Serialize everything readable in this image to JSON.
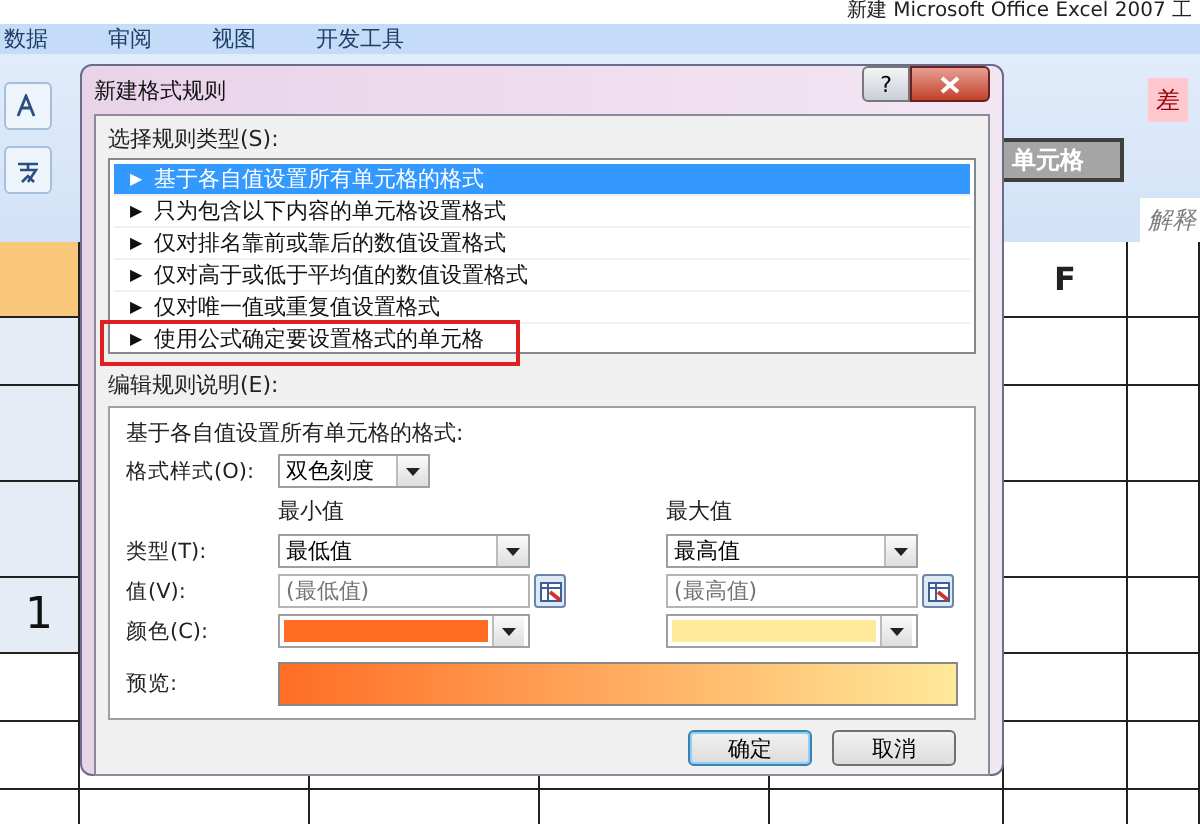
{
  "app_title": "新建 Microsoft Office Excel 2007 工",
  "ribbon_tabs": [
    {
      "label": "数据"
    },
    {
      "label": "审阅"
    },
    {
      "label": "视图"
    },
    {
      "label": "开发工具"
    }
  ],
  "cell_styles": [
    {
      "label": "差",
      "kind": "bad"
    },
    {
      "label": "单元格",
      "kind": "check"
    },
    {
      "label": "解释",
      "kind": "note"
    }
  ],
  "sheet": {
    "column_header": "F",
    "cell_text": "1"
  },
  "dialog": {
    "title": "新建格式规则",
    "help": "?",
    "rule_type_label": "选择规则类型(S):",
    "rule_types": [
      {
        "arrow": "▶",
        "label": "基于各自值设置所有单元格的格式",
        "selected": true,
        "highlighted": false
      },
      {
        "arrow": "▶",
        "label": "只为包含以下内容的单元格设置格式",
        "selected": false,
        "highlighted": false
      },
      {
        "arrow": "▶",
        "label": "仅对排名靠前或靠后的数值设置格式",
        "selected": false,
        "highlighted": false
      },
      {
        "arrow": "▶",
        "label": "仅对高于或低于平均值的数值设置格式",
        "selected": false,
        "highlighted": false
      },
      {
        "arrow": "▶",
        "label": "仅对唯一值或重复值设置格式",
        "selected": false,
        "highlighted": false
      },
      {
        "arrow": "▶",
        "label": "使用公式确定要设置格式的单元格",
        "selected": false,
        "highlighted": true
      }
    ],
    "edit_label": "编辑规则说明(E):",
    "description": "基于各自值设置所有单元格的格式:",
    "format_style_label": "格式样式(O):",
    "format_style": "双色刻度",
    "type_label": "类型(T):",
    "value_label": "值(V):",
    "color_label": "颜色(C):",
    "scale": [
      {
        "header": "最小值",
        "type": "最低值",
        "placeholder": "(最低值)",
        "color": "#ff6d24"
      },
      {
        "header": "最大值",
        "type": "最高值",
        "placeholder": "(最高值)",
        "color": "#ffe99a"
      }
    ],
    "preview_label": "预览:",
    "buttons": [
      {
        "label": "确定",
        "default": true
      },
      {
        "label": "取消",
        "default": false
      }
    ]
  }
}
